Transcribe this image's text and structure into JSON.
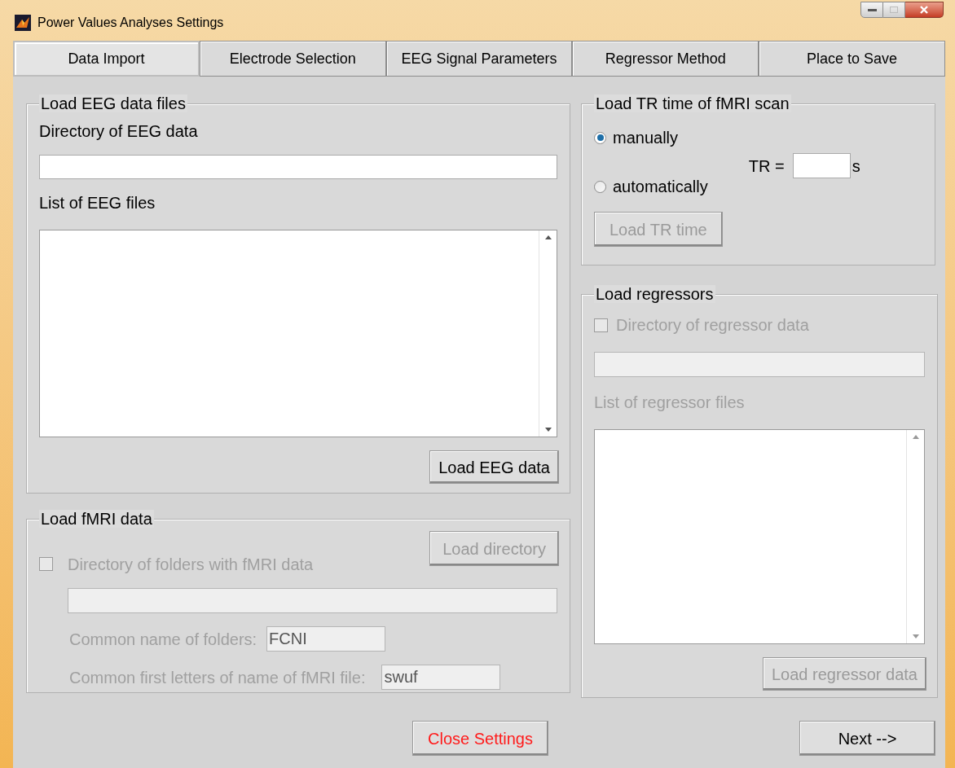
{
  "window": {
    "title": "Power Values Analyses Settings"
  },
  "tabs": [
    {
      "label": "Data Import",
      "selected": true
    },
    {
      "label": "Electrode Selection",
      "selected": false
    },
    {
      "label": "EEG Signal Parameters",
      "selected": false
    },
    {
      "label": "Regressor Method",
      "selected": false
    },
    {
      "label": "Place to Save",
      "selected": false
    }
  ],
  "eeg_panel": {
    "title": "Load EEG data files",
    "directory_label": "Directory of EEG data",
    "list_label": "List of EEG files",
    "load_button": {
      "label": "Load EEG data",
      "disabled": false
    }
  },
  "fmri_panel": {
    "title": "Load fMRI data",
    "checkbox": {
      "label": "Directory of folders with fMRI data",
      "checked": false,
      "disabled": true
    },
    "load_button": {
      "label": "Load directory",
      "disabled": true
    },
    "folder_name": {
      "label": "Common name of folders:",
      "value": "FCNI"
    },
    "file_prefix": {
      "label": "Common first letters of name of fMRI file:",
      "value": "swuf"
    }
  },
  "tr_panel": {
    "title": "Load TR time of fMRI scan",
    "options": [
      {
        "label": "manually",
        "selected": true
      },
      {
        "label": "automatically",
        "selected": false
      }
    ],
    "tr_label": "TR =",
    "unit": "s",
    "load_button": {
      "label": "Load TR time",
      "disabled": true
    }
  },
  "regressor_panel": {
    "title": "Load regressors",
    "checkbox": {
      "label": "Directory of regressor data",
      "checked": false,
      "disabled": true
    },
    "list_label": "List of regressor files",
    "load_button": {
      "label": "Load regressor data",
      "disabled": true
    }
  },
  "buttons": [
    {
      "label": "Close Settings",
      "kind": "close"
    },
    {
      "label": "Next -->",
      "kind": "next"
    }
  ]
}
